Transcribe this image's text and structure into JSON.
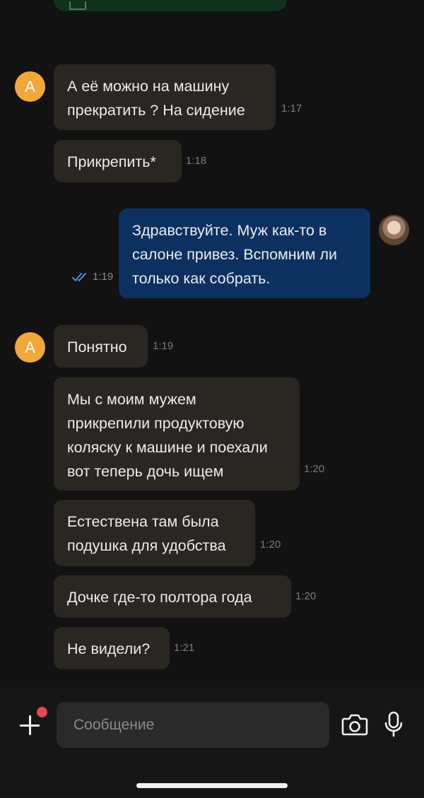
{
  "contact": {
    "initial": "А"
  },
  "messages": [
    {
      "dir": "in",
      "text": "А её можно на машину\nпрекратить ? На сидение",
      "time": "1:17"
    },
    {
      "dir": "in",
      "text": "Прикрепить*",
      "time": "1:18"
    },
    {
      "dir": "out",
      "text": "Здравствуйте. Муж как-то в\nсалоне привез. Вспомним ли\nтолько как собрать.",
      "time": "1:19",
      "status": "read"
    },
    {
      "dir": "in",
      "text": "Понятно",
      "time": "1:19"
    },
    {
      "dir": "in",
      "text": "Мы с моим мужем\nприкрепили продуктовую\nколяску к машине и поехали\nвот теперь дочь ищем",
      "time": "1:20"
    },
    {
      "dir": "in",
      "text": "Естествена там была\nподушка для удобства",
      "time": "1:20"
    },
    {
      "dir": "in",
      "text": "Дочке где-то полтора года",
      "time": "1:20"
    },
    {
      "dir": "in",
      "text": "Не видели?",
      "time": "1:21"
    }
  ],
  "composer": {
    "placeholder": "Сообщение"
  },
  "colors": {
    "incoming_bubble": "#2a2723",
    "outgoing_bubble": "#0c3160",
    "avatar": "#f2a73b",
    "read_ticks": "#4a9eff",
    "badge": "#e5484d"
  },
  "icons": [
    "add-icon",
    "camera-icon",
    "microphone-icon",
    "double-check-icon"
  ]
}
